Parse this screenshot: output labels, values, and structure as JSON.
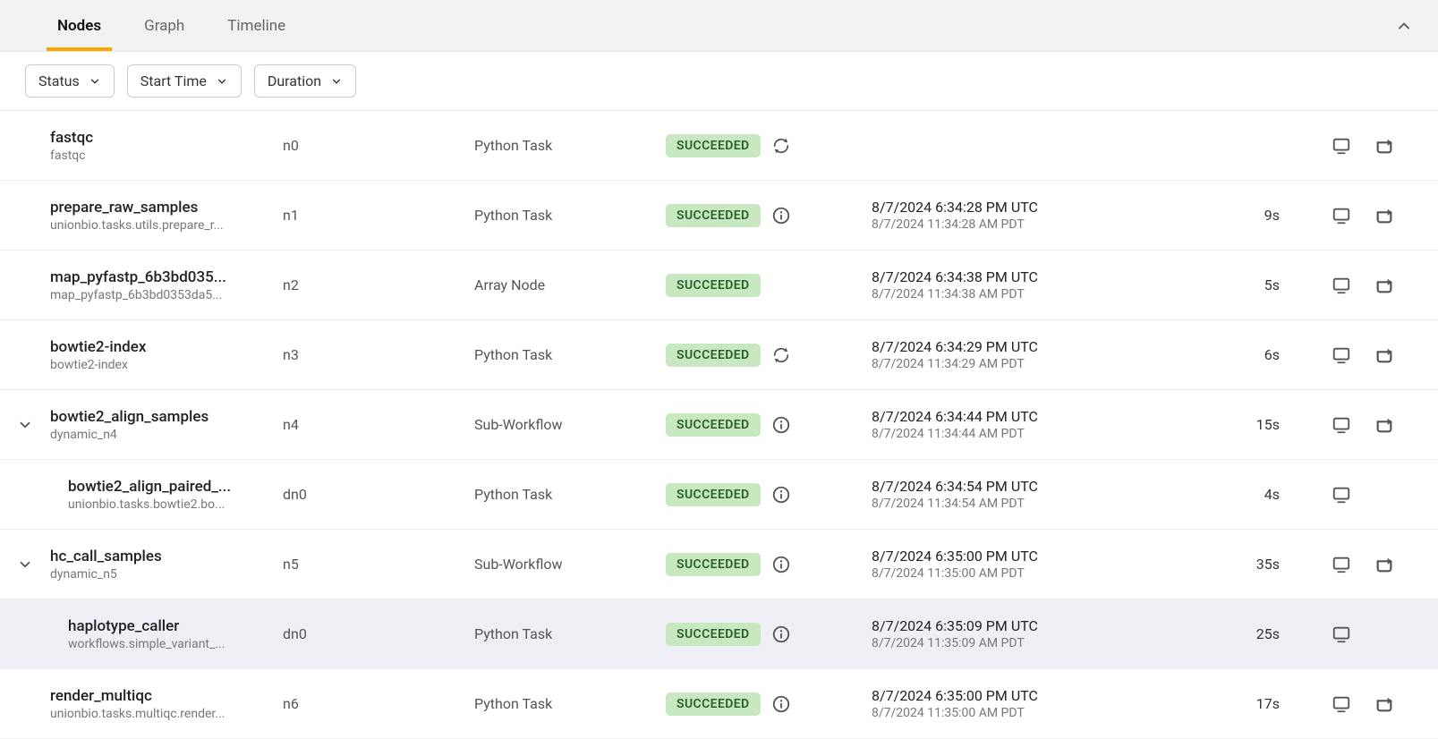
{
  "tabs": [
    {
      "label": "Nodes",
      "active": true
    },
    {
      "label": "Graph",
      "active": false
    },
    {
      "label": "Timeline",
      "active": false
    }
  ],
  "filters": [
    {
      "label": "Status"
    },
    {
      "label": "Start Time"
    },
    {
      "label": "Duration"
    }
  ],
  "rows": [
    {
      "expandable": false,
      "nested": false,
      "hl": false,
      "name": "fastqc",
      "sub": "fastqc",
      "nodeid": "n0",
      "type": "Python Task",
      "status": "SUCCEEDED",
      "status_icon": "refresh",
      "time_primary": "",
      "time_secondary": "",
      "duration": "",
      "logs": true,
      "rerun": true
    },
    {
      "expandable": false,
      "nested": false,
      "hl": false,
      "name": "prepare_raw_samples",
      "sub": "unionbio.tasks.utils.prepare_r...",
      "nodeid": "n1",
      "type": "Python Task",
      "status": "SUCCEEDED",
      "status_icon": "info",
      "time_primary": "8/7/2024 6:34:28 PM UTC",
      "time_secondary": "8/7/2024 11:34:28 AM PDT",
      "duration": "9s",
      "logs": true,
      "rerun": true
    },
    {
      "expandable": false,
      "nested": false,
      "hl": false,
      "name": "map_pyfastp_6b3bd035...",
      "sub": "map_pyfastp_6b3bd0353da5...",
      "nodeid": "n2",
      "type": "Array Node",
      "status": "SUCCEEDED",
      "status_icon": "",
      "time_primary": "8/7/2024 6:34:38 PM UTC",
      "time_secondary": "8/7/2024 11:34:38 AM PDT",
      "duration": "5s",
      "logs": true,
      "rerun": true
    },
    {
      "expandable": false,
      "nested": false,
      "hl": false,
      "name": "bowtie2-index",
      "sub": "bowtie2-index",
      "nodeid": "n3",
      "type": "Python Task",
      "status": "SUCCEEDED",
      "status_icon": "refresh",
      "time_primary": "8/7/2024 6:34:29 PM UTC",
      "time_secondary": "8/7/2024 11:34:29 AM PDT",
      "duration": "6s",
      "logs": true,
      "rerun": true
    },
    {
      "expandable": true,
      "nested": false,
      "hl": false,
      "name": "bowtie2_align_samples",
      "sub": "dynamic_n4",
      "nodeid": "n4",
      "type": "Sub-Workflow",
      "status": "SUCCEEDED",
      "status_icon": "info",
      "time_primary": "8/7/2024 6:34:44 PM UTC",
      "time_secondary": "8/7/2024 11:34:44 AM PDT",
      "duration": "15s",
      "logs": true,
      "rerun": true
    },
    {
      "expandable": false,
      "nested": true,
      "hl": false,
      "name": "bowtie2_align_paired_...",
      "sub": "unionbio.tasks.bowtie2.bo...",
      "nodeid": "dn0",
      "type": "Python Task",
      "status": "SUCCEEDED",
      "status_icon": "info",
      "time_primary": "8/7/2024 6:34:54 PM UTC",
      "time_secondary": "8/7/2024 11:34:54 AM PDT",
      "duration": "4s",
      "logs": true,
      "rerun": false
    },
    {
      "expandable": true,
      "nested": false,
      "hl": false,
      "name": "hc_call_samples",
      "sub": "dynamic_n5",
      "nodeid": "n5",
      "type": "Sub-Workflow",
      "status": "SUCCEEDED",
      "status_icon": "info",
      "time_primary": "8/7/2024 6:35:00 PM UTC",
      "time_secondary": "8/7/2024 11:35:00 AM PDT",
      "duration": "35s",
      "logs": true,
      "rerun": true
    },
    {
      "expandable": false,
      "nested": true,
      "hl": true,
      "name": "haplotype_caller",
      "sub": "workflows.simple_variant_...",
      "nodeid": "dn0",
      "type": "Python Task",
      "status": "SUCCEEDED",
      "status_icon": "info",
      "time_primary": "8/7/2024 6:35:09 PM UTC",
      "time_secondary": "8/7/2024 11:35:09 AM PDT",
      "duration": "25s",
      "logs": true,
      "rerun": false
    },
    {
      "expandable": false,
      "nested": false,
      "hl": false,
      "name": "render_multiqc",
      "sub": "unionbio.tasks.multiqc.render...",
      "nodeid": "n6",
      "type": "Python Task",
      "status": "SUCCEEDED",
      "status_icon": "info",
      "time_primary": "8/7/2024 6:35:00 PM UTC",
      "time_secondary": "8/7/2024 11:35:00 AM PDT",
      "duration": "17s",
      "logs": true,
      "rerun": true
    }
  ]
}
